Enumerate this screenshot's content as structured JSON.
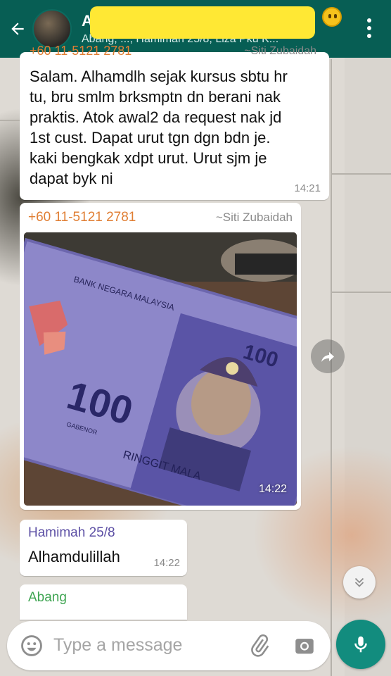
{
  "header": {
    "title": "A",
    "members": "Abang, ..., Hamimah 25/8, Liza Pku K..."
  },
  "messages": [
    {
      "cut_sender": "+60 11-5121 2781",
      "cut_right": "~Siti Zubaidah",
      "text": "Salam. Alhamdlh sejak kursus sbtu hr tu, bru smlm brksmptn dn berani nak praktis. Atok awal2 da request nak jd 1st cust. Dapat urut tgn dgn bdn je. kaki bengkak xdpt urut. Urut sjm je dapat byk ni",
      "time": "14:21"
    },
    {
      "sender": "+60 11-5121 2781",
      "pushname": "~Siti Zubaidah",
      "photo": {
        "bank_text": "BANK NEGARA MALAYSIA",
        "denomination": "100",
        "currency_text": "RINGGIT MALA",
        "signature_label": "GABENOR"
      },
      "time": "14:22"
    },
    {
      "sender": "Hamimah 25/8",
      "text": "Alhamdulillah",
      "time": "14:22"
    },
    {
      "sender": "Abang"
    }
  ],
  "input": {
    "placeholder": "Type a message"
  },
  "icons": {
    "back": "arrow-left-icon",
    "menu": "more-vertical-icon",
    "forward": "forward-icon",
    "scroll": "double-chevron-down-icon",
    "emoji": "emoji-icon",
    "attach": "paperclip-icon",
    "camera": "camera-icon",
    "mic": "mic-icon"
  },
  "colors": {
    "header": "#075e54",
    "mic": "#128c7e",
    "sender_orange": "#e07e33",
    "sender_purple": "#5d50a5",
    "sender_green": "#3fa552"
  }
}
